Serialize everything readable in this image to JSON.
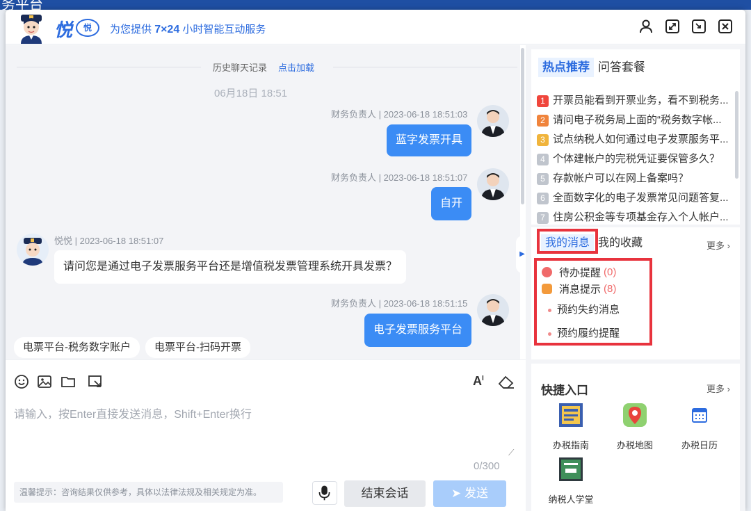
{
  "background": {
    "title_fragment": "务平台"
  },
  "header": {
    "logo_text": "悦",
    "logo_badge": "悦",
    "slogan_prefix": "为您提供",
    "slogan_bold": "7×24",
    "slogan_suffix": "小时智能互动服务",
    "icons": [
      "user-icon",
      "expand-icon",
      "minimize-icon",
      "close-icon"
    ]
  },
  "chat": {
    "history_label": "历史聊天记录",
    "history_load": "点击加载",
    "date_stamp": "06月18日 18:51",
    "messages": [
      {
        "side": "right",
        "meta": "财务负责人 | 2023-06-18 18:51:03",
        "text": "蓝字发票开具"
      },
      {
        "side": "right",
        "meta": "财务负责人 | 2023-06-18 18:51:07",
        "text": "自开"
      },
      {
        "side": "left",
        "meta": "悦悦 | 2023-06-18 18:51:07",
        "text": "请问您是通过电子发票服务平台还是增值税发票管理系统开具发票？"
      },
      {
        "side": "right",
        "meta": "财务负责人 | 2023-06-18 18:51:15",
        "text": "电子发票服务平台"
      }
    ],
    "quick_chips": [
      "电票平台-税务数字账户",
      "电票平台-扫码开票"
    ]
  },
  "input": {
    "placeholder": "请输入，按Enter直接发送消息，Shift+Enter换行",
    "counter": "0/300",
    "tip": "温馨提示：咨询结果仅供参考，具体以法律法规及相关规定为准。",
    "end_label": "结束会话",
    "send_label": "发送",
    "font_label": "A"
  },
  "hot": {
    "tab_active": "热点推荐",
    "tab_other": "问答套餐",
    "items": [
      {
        "n": "1",
        "text": "开票员能看到开票业务，看不到税务...",
        "color": "#f0463c"
      },
      {
        "n": "2",
        "text": "请问电子税务局上面的“税务数字帐...",
        "color": "#f0843c"
      },
      {
        "n": "3",
        "text": "试点纳税人如何通过电子发票服务平...",
        "color": "#f0b43c"
      },
      {
        "n": "4",
        "text": "个体建帐户的完税凭证要保管多久？",
        "color": "#c0c5cd"
      },
      {
        "n": "5",
        "text": "存款帐户可以在网上备案吗？",
        "color": "#c0c5cd"
      },
      {
        "n": "6",
        "text": "全面数字化的电子发票常见问题答复...",
        "color": "#c0c5cd"
      },
      {
        "n": "7",
        "text": "住房公积金等专项基金存入个人帐户...",
        "color": "#c0c5cd"
      }
    ]
  },
  "messages_panel": {
    "tab_active": "我的消息",
    "tab_other": "我的收藏",
    "more": "更多 ›",
    "todo_label": "待办提醒",
    "todo_count": "(0)",
    "notice_label": "消息提示",
    "notice_count": "(8)",
    "sub_items": [
      "预约失约消息",
      "预约履约提醒"
    ]
  },
  "quick_entry": {
    "title": "快捷入口",
    "more": "更多 ›",
    "items": [
      "办税指南",
      "办税地图",
      "办税日历",
      "纳税人学堂"
    ]
  },
  "colors": {
    "accent": "#2d6cdf",
    "bubble": "#3b8cf5",
    "highlight": "#e8333d"
  }
}
